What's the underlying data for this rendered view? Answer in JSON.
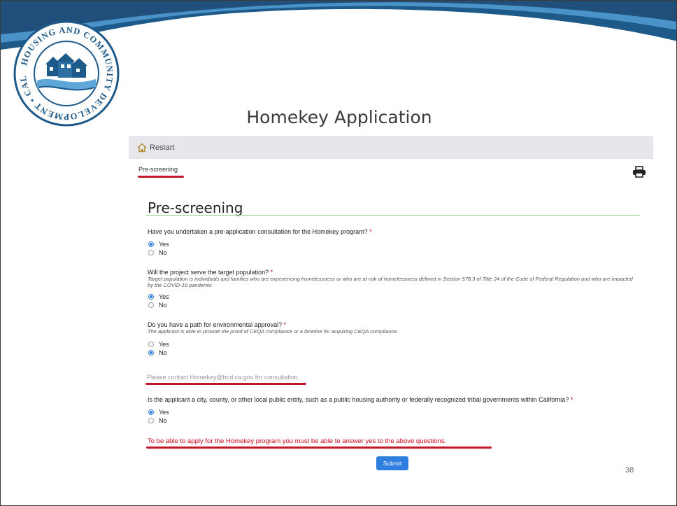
{
  "slide": {
    "title": "Homekey Application",
    "page_number": "38"
  },
  "seal": {
    "text": "HOUSING AND COMMUNITY DEVELOPMENT • CALIFORNIA •",
    "colors": {
      "ring": "#1d5a8a",
      "house": "#1d5a8a",
      "wave": "#2b6fa3"
    }
  },
  "toolbar": {
    "restart_label": "Restart",
    "restart_icon": "home-icon",
    "print_icon": "printer-icon"
  },
  "breadcrumb": {
    "current": "Pre-screening"
  },
  "form": {
    "section_title": "Pre-screening",
    "questions": [
      {
        "label": "Have you undertaken a pre-application consultation for the Homekey program?",
        "required_marker": "*",
        "hint": "",
        "options": [
          "Yes",
          "No"
        ],
        "selected": "Yes"
      },
      {
        "label": "Will the project serve the target population?",
        "required_marker": "*",
        "hint": "Target population is individuals and families who are experiencing homelessness or who are at risk of homelessness defined in Section 578.3 of Title 24 of the Code of Federal Regulation and who are impacted by the COVID-19 pandemic.",
        "options": [
          "Yes",
          "No"
        ],
        "selected": "Yes"
      },
      {
        "label": "Do you have a path for environmental approval?",
        "required_marker": "*",
        "hint": "The applicant is able to provide the proof of CEQA compliance or a timeline for acquiring CEQA compliance.",
        "options": [
          "Yes",
          "No"
        ],
        "selected": "No"
      },
      {
        "label": "Is the applicant a city, county, or other local public entity, such as a public housing authority or federally recognized tribal governments within California?",
        "required_marker": "*",
        "hint": "",
        "options": [
          "Yes",
          "No"
        ],
        "selected": "Yes"
      }
    ],
    "contact_note": "Please contact Homekey@hcd.ca.gov for consultation.",
    "warning": "To be able to apply for the Homekey program you must be able to answer yes to the above questions.",
    "submit_label": "Submit"
  },
  "colors": {
    "accent_blue": "#2f7fe0",
    "annotation_red": "#c0182a",
    "required_red": "#d0021b",
    "wave_dark": "#1d5a8a",
    "wave_light": "#5fa7d8"
  }
}
